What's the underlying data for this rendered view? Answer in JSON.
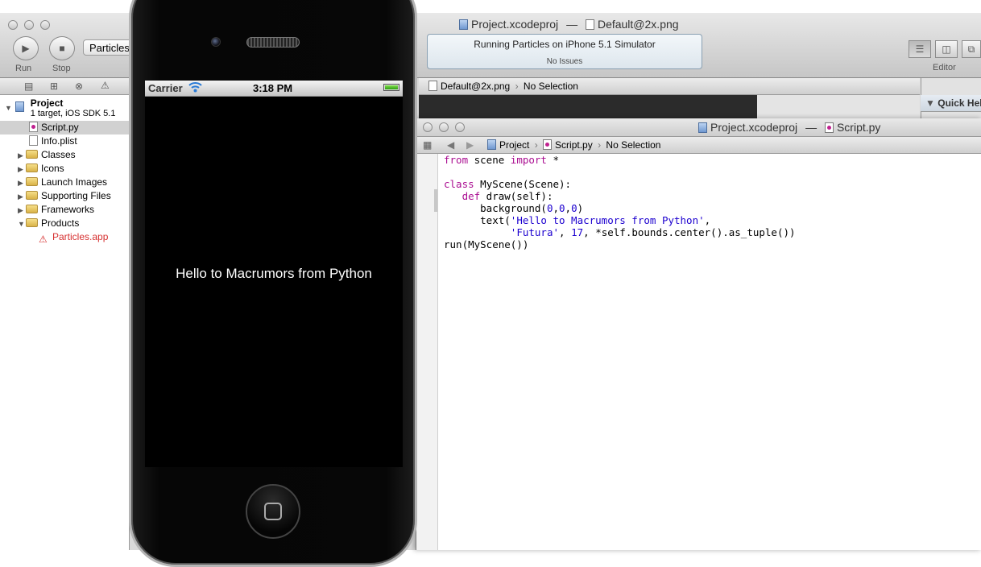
{
  "xcode": {
    "window_title": {
      "project": "Project.xcodeproj",
      "separator": "—",
      "file": "Default@2x.png"
    },
    "toolbar": {
      "run_label": "Run",
      "stop_label": "Stop",
      "scheme_label": "Particles",
      "editor_label": "Editor"
    },
    "activity": {
      "status": "Running Particles on iPhone 5.1 Simulator",
      "issues": "No Issues"
    },
    "navigator": {
      "project_name": "Project",
      "project_subtitle": "1 target, iOS SDK 5.1",
      "items": [
        {
          "label": "Script.py",
          "kind": "python-file",
          "selected": true
        },
        {
          "label": "Info.plist",
          "kind": "file"
        },
        {
          "label": "Classes",
          "kind": "folder"
        },
        {
          "label": "Icons",
          "kind": "folder"
        },
        {
          "label": "Launch Images",
          "kind": "folder"
        },
        {
          "label": "Supporting Files",
          "kind": "folder"
        },
        {
          "label": "Frameworks",
          "kind": "folder"
        },
        {
          "label": "Products",
          "kind": "folder",
          "expanded": true
        },
        {
          "label": "Particles.app",
          "kind": "app",
          "color": "#d62f2f"
        }
      ]
    },
    "jumpbar": {
      "file": "Default@2x.png",
      "selection": "No Selection"
    },
    "utility": {
      "quick_help": "Quick Help"
    }
  },
  "script_window": {
    "title": {
      "project": "Project.xcodeproj",
      "separator": "—",
      "file": "Script.py"
    },
    "jumpbar": {
      "project": "Project",
      "file": "Script.py",
      "selection": "No Selection"
    },
    "code": [
      "from scene import *",
      "",
      "class MyScene(Scene):",
      "   def draw(self):",
      "      background(0,0,0)",
      "      text('Hello to Macrumors from Python',",
      "           'Futura', 17, *self.bounds.center().as_tuple())",
      "run(MyScene())"
    ]
  },
  "simulator": {
    "carrier": "Carrier",
    "time": "3:18 PM",
    "battery_level": 1.0,
    "scene_text": "Hello to Macrumors from Python"
  }
}
